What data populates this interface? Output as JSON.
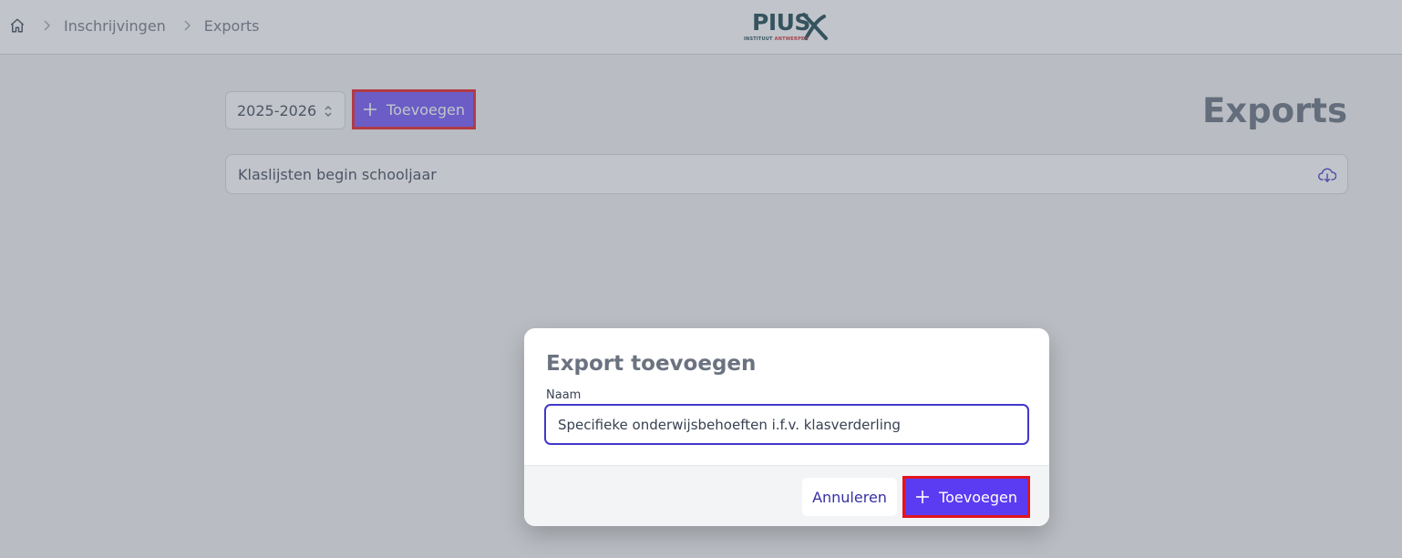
{
  "breadcrumb": {
    "home_icon": "home-icon",
    "separator_icon": "chevron-right-icon",
    "items": [
      "Inschrijvingen",
      "Exports"
    ]
  },
  "logo": {
    "text": "PIUS",
    "subtext_main": "INSTITUUT",
    "subtext_accent": "ANTWERPEN"
  },
  "toolbar": {
    "year_value": "2025-2026",
    "year_icon": "chevron-updown-icon",
    "add_label": "Toevoegen",
    "add_icon": "plus-icon"
  },
  "page": {
    "title": "Exports"
  },
  "exports_list": [
    {
      "name": "Klaslijsten begin schooljaar",
      "action_icon": "cloud-download-icon"
    }
  ],
  "dialog": {
    "title": "Export toevoegen",
    "name_label": "Naam",
    "name_value": "Specifieke onderwijsbehoeften i.f.v. klasverderling",
    "cancel_label": "Annuleren",
    "add_label": "Toevoegen"
  },
  "colors": {
    "primary": "#5b3cf2",
    "highlight_border": "#e3141d",
    "logo_teal": "#0f3d45",
    "logo_red": "#d0202a"
  }
}
